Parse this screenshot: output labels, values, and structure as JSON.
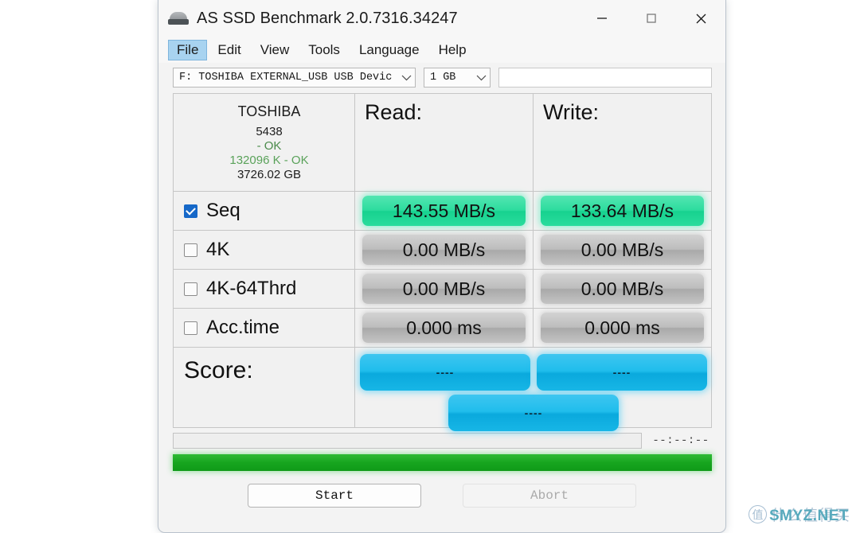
{
  "window": {
    "title": "AS SSD Benchmark 2.0.7316.34247",
    "app_icon": "hard-disk-icon",
    "controls": {
      "minimize": "minimize-icon",
      "maximize": "maximize-icon",
      "close": "close-icon"
    }
  },
  "menu": {
    "items": [
      {
        "label": "File",
        "active": true
      },
      {
        "label": "Edit",
        "active": false
      },
      {
        "label": "View",
        "active": false
      },
      {
        "label": "Tools",
        "active": false
      },
      {
        "label": "Language",
        "active": false
      },
      {
        "label": "Help",
        "active": false
      }
    ]
  },
  "toolbar": {
    "drive_selected": "F: TOSHIBA EXTERNAL_USB USB Devic",
    "size_selected": "1 GB",
    "info_field_value": ""
  },
  "drive_info": {
    "model": "TOSHIBA",
    "firmware": "5438",
    "driver_status": "- OK",
    "alignment": "132096 K - OK",
    "capacity": "3726.02 GB"
  },
  "columns": {
    "read": "Read:",
    "write": "Write:"
  },
  "measurements": [
    {
      "name": "Seq",
      "checked": true,
      "read": "143.55 MB/s",
      "write": "133.64 MB/s",
      "state": "done"
    },
    {
      "name": "4K",
      "checked": false,
      "read": "0.00 MB/s",
      "write": "0.00 MB/s",
      "state": "idle"
    },
    {
      "name": "4K-64Thrd",
      "checked": false,
      "read": "0.00 MB/s",
      "write": "0.00 MB/s",
      "state": "idle"
    },
    {
      "name": "Acc.time",
      "checked": false,
      "read": "0.000 ms",
      "write": "0.000 ms",
      "state": "idle"
    }
  ],
  "score": {
    "label": "Score:",
    "read_score": "----",
    "write_score": "----",
    "total_score": "----"
  },
  "status": {
    "status_field_value": "",
    "elapsed": "--:--:--",
    "progress_percent": 100
  },
  "buttons": {
    "start": "Start",
    "abort": "Abort"
  },
  "watermark": {
    "mark": "值",
    "cn_text": "什么值得买",
    "site": "SMYZ.NET"
  },
  "colors": {
    "accent_green": "#2ddc9e",
    "accent_blue": "#20bdec",
    "progress_green": "#17a51f",
    "checkbox_blue": "#1668c8",
    "menu_highlight": "#a8d3f0"
  }
}
